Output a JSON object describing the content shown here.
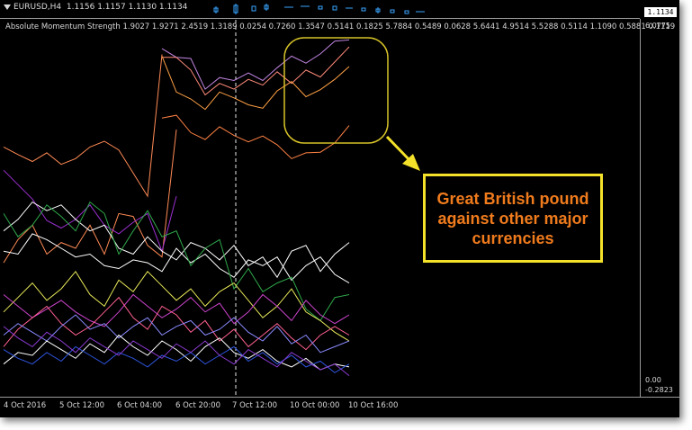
{
  "top_pane": {
    "symbol_title": "EURUSD,H4",
    "ohlc": "1.1156 1.1157 1.1130 1.1134",
    "price_badge": "1.1134"
  },
  "indicator": {
    "title": "Absolute Momentum Strength",
    "values_text": "1.9027 1.9271 2.4519 1.3189 0.0254 0.7260 1.3547 0.5141 0.1825 5.7884 0.5489 0.0628 5.6441 4.9514 5.5288 0.5114 1.1090 0.5881 0.1119"
  },
  "axis": {
    "top_label": "6.0775",
    "zero_label": "0.00",
    "bottom_label": "-0.2823"
  },
  "time_axis": [
    "4 Oct 2016",
    "5 Oct 12:00",
    "6 Oct 04:00",
    "6 Oct 20:00",
    "7 Oct 12:00",
    "10 Oct 00:00",
    "10 Oct 16:00"
  ],
  "callout": {
    "text": "Great British pound against other major currencies",
    "border_color": "#f4e12a",
    "text_color": "#f07b1d"
  },
  "chart_data": {
    "type": "line",
    "title": "Absolute Momentum Strength",
    "x": [
      "4 Oct 2016",
      "",
      "",
      "",
      "5 Oct 12:00",
      "",
      "",
      "",
      "6 Oct 04:00",
      "",
      "",
      "",
      "6 Oct 20:00",
      "",
      "",
      "",
      "7 Oct 12:00",
      "",
      "",
      "",
      "10 Oct 00:00",
      "",
      "",
      "",
      "10 Oct 16:00"
    ],
    "ylim": [
      -0.2823,
      6.0775
    ],
    "grid": false,
    "marker": {
      "x": "7 Oct 12:00",
      "style": "dashed"
    },
    "series": [
      {
        "color": "#c084e0",
        "values": [
          null,
          null,
          null,
          null,
          null,
          null,
          null,
          null,
          null,
          null,
          null,
          5.75,
          5.6,
          5.58,
          5.05,
          5.25,
          5.2,
          5.33,
          5.2,
          5.42,
          5.62,
          5.5,
          5.66,
          5.88,
          5.9
        ]
      },
      {
        "color": "#ff8a7a",
        "values": [
          null,
          null,
          null,
          null,
          null,
          null,
          null,
          null,
          null,
          null,
          null,
          5.6,
          5.6,
          5.38,
          4.95,
          5.15,
          5.05,
          5.22,
          5.12,
          5.35,
          5.15,
          5.38,
          5.26,
          5.52,
          5.78
        ]
      },
      {
        "color": "#ffa045",
        "values": [
          null,
          null,
          null,
          null,
          null,
          null,
          null,
          null,
          null,
          null,
          null,
          5.62,
          5.0,
          4.88,
          4.7,
          5.0,
          4.9,
          4.78,
          4.72,
          5.02,
          5.18,
          4.92,
          5.04,
          5.22,
          5.44
        ]
      },
      {
        "color": "#ff8244",
        "values": [
          null,
          null,
          null,
          null,
          null,
          null,
          null,
          null,
          null,
          null,
          null,
          4.55,
          4.6,
          4.3,
          4.18,
          4.4,
          4.25,
          4.14,
          4.24,
          4.09,
          3.85,
          3.95,
          3.96,
          4.12,
          4.42
        ]
      },
      {
        "color": "#ff8a55",
        "values": [
          4.05,
          3.92,
          3.8,
          3.95,
          3.75,
          3.85,
          4.05,
          4.15,
          4.0,
          3.6,
          3.2,
          5.65,
          null,
          null,
          null,
          null,
          null,
          null,
          null,
          null,
          null,
          null,
          null,
          null,
          null
        ]
      },
      {
        "color": "#ff8a55",
        "values": [
          2.05,
          2.45,
          2.7,
          2.2,
          2.4,
          2.3,
          2.7,
          2.2,
          2.9,
          2.85,
          2.35,
          2.15,
          4.35,
          null,
          null,
          null,
          null,
          null,
          null,
          null,
          null,
          null,
          null,
          null,
          null
        ]
      },
      {
        "color": "#9b2fd0",
        "values": [
          3.65,
          3.4,
          3.15,
          2.78,
          2.65,
          2.8,
          3.05,
          2.7,
          2.55,
          2.75,
          2.9,
          2.25,
          3.2,
          null,
          null,
          null,
          null,
          null,
          null,
          null,
          null,
          null,
          null,
          null,
          null
        ]
      },
      {
        "color": "#ffffff",
        "values": [
          2.6,
          2.8,
          3.1,
          2.95,
          3.05,
          2.8,
          2.6,
          2.7,
          2.3,
          2.2,
          2.5,
          2.25,
          2.1,
          2.4,
          2.3,
          2.1,
          2.35,
          2.0,
          2.15,
          1.8,
          2.25,
          2.35,
          1.9,
          2.2,
          2.4
        ]
      },
      {
        "color": "#ffffff",
        "values": [
          2.25,
          2.2,
          2.55,
          2.45,
          2.3,
          2.15,
          2.2,
          2.0,
          1.95,
          2.1,
          2.05,
          1.9,
          2.3,
          2.05,
          2.2,
          1.95,
          1.8,
          2.1,
          2.0,
          2.15,
          1.75,
          2.0,
          2.15,
          1.85,
          1.7
        ]
      },
      {
        "color": "#2fa84a",
        "values": [
          2.9,
          2.5,
          2.7,
          3.05,
          2.85,
          2.6,
          3.1,
          2.9,
          2.2,
          2.6,
          2.95,
          2.5,
          2.6,
          2.0,
          2.3,
          2.45,
          1.6,
          1.95,
          1.55,
          1.7,
          1.8,
          1.25,
          1.05,
          1.45,
          1.5
        ]
      },
      {
        "color": "#e8e85a",
        "values": [
          1.2,
          1.45,
          1.7,
          1.4,
          1.6,
          1.9,
          1.5,
          1.3,
          1.75,
          1.55,
          1.9,
          1.65,
          1.4,
          1.6,
          1.3,
          1.55,
          1.7,
          1.4,
          1.1,
          1.3,
          1.6,
          1.2,
          1.05,
          0.85,
          0.7
        ]
      },
      {
        "color": "#cc44cc",
        "values": [
          1.5,
          1.3,
          1.1,
          1.25,
          1.4,
          1.2,
          1.05,
          0.95,
          1.2,
          1.5,
          1.3,
          1.1,
          1.25,
          1.45,
          1.2,
          1.35,
          1.0,
          1.2,
          1.5,
          1.3,
          1.05,
          1.4,
          1.15,
          1.0,
          1.15
        ]
      },
      {
        "color": "#ff6090",
        "values": [
          0.6,
          0.9,
          1.1,
          1.3,
          1.0,
          0.8,
          0.95,
          1.2,
          1.45,
          1.1,
          0.9,
          1.3,
          1.15,
          0.85,
          1.05,
          0.7,
          0.9,
          0.6,
          0.8,
          1.0,
          0.75,
          0.55,
          0.8,
          0.95,
          0.8
        ]
      },
      {
        "color": "#8a8aff",
        "values": [
          0.8,
          1.0,
          0.85,
          0.7,
          0.95,
          1.15,
          0.9,
          1.0,
          0.75,
          0.95,
          1.1,
          0.8,
          0.95,
          1.05,
          0.8,
          0.9,
          1.1,
          0.85,
          0.7,
          0.95,
          0.65,
          0.8,
          0.5,
          0.6,
          0.7
        ]
      },
      {
        "color": "#ffffff",
        "values": [
          0.3,
          0.5,
          0.45,
          0.7,
          0.55,
          0.4,
          0.65,
          0.5,
          0.8,
          0.6,
          0.45,
          0.7,
          0.55,
          0.35,
          0.6,
          0.75,
          0.5,
          0.4,
          0.55,
          0.35,
          0.25,
          0.4,
          0.2,
          0.3,
          0.25
        ]
      },
      {
        "color": "#2f55e0",
        "values": [
          0.55,
          0.4,
          0.3,
          0.5,
          0.35,
          0.6,
          0.45,
          0.3,
          0.5,
          0.4,
          0.25,
          0.45,
          0.35,
          0.5,
          0.3,
          0.45,
          0.6,
          0.35,
          0.5,
          0.3,
          0.45,
          0.25,
          0.35,
          0.15,
          0.3
        ]
      },
      {
        "color": "#8a3ad0",
        "values": [
          0.95,
          0.75,
          0.6,
          0.85,
          0.7,
          0.5,
          0.75,
          0.6,
          0.45,
          0.7,
          0.55,
          0.4,
          0.65,
          0.5,
          0.7,
          0.45,
          0.3,
          0.55,
          0.4,
          0.25,
          0.5,
          0.35,
          0.2,
          0.3,
          0.1
        ]
      }
    ]
  }
}
